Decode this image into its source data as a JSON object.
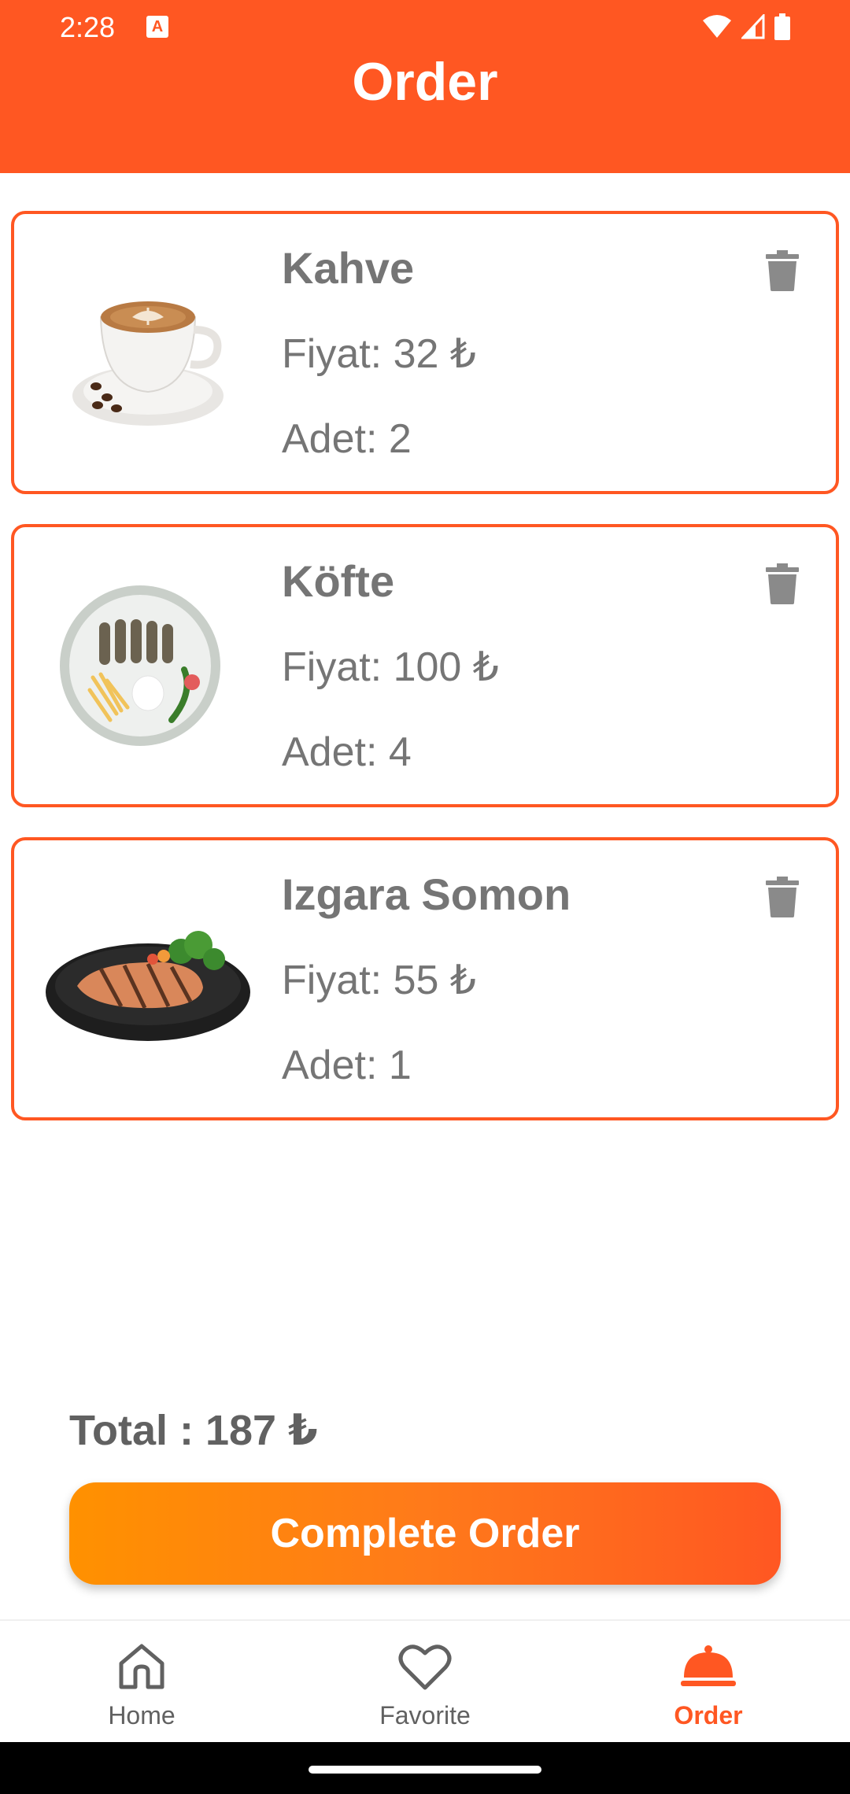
{
  "status_bar": {
    "time": "2:28",
    "icons": [
      "a-icon",
      "wifi-icon",
      "signal-icon",
      "battery-icon"
    ]
  },
  "app_bar": {
    "title": "Order"
  },
  "orders": [
    {
      "name": "Kahve",
      "price": "Fiyat: 32 ₺",
      "quantity": "Adet: 2",
      "image": "coffee-cup"
    },
    {
      "name": "Köfte",
      "price": "Fiyat: 100 ₺",
      "quantity": "Adet: 4",
      "image": "kofte-plate"
    },
    {
      "name": "Izgara Somon",
      "price": "Fiyat: 55 ₺",
      "quantity": "Adet: 1",
      "image": "grilled-salmon-plate"
    }
  ],
  "summary": {
    "total": "Total : 187 ₺",
    "complete_label": "Complete Order"
  },
  "bottom_nav": {
    "items": [
      {
        "label": "Home",
        "icon": "home-icon",
        "active": false
      },
      {
        "label": "Favorite",
        "icon": "heart-icon",
        "active": false
      },
      {
        "label": "Order",
        "icon": "cloche-icon",
        "active": true
      }
    ]
  },
  "colors": {
    "primary": "#FF5722",
    "gradient_start": "#FF9100",
    "text_gray": "#757575"
  }
}
